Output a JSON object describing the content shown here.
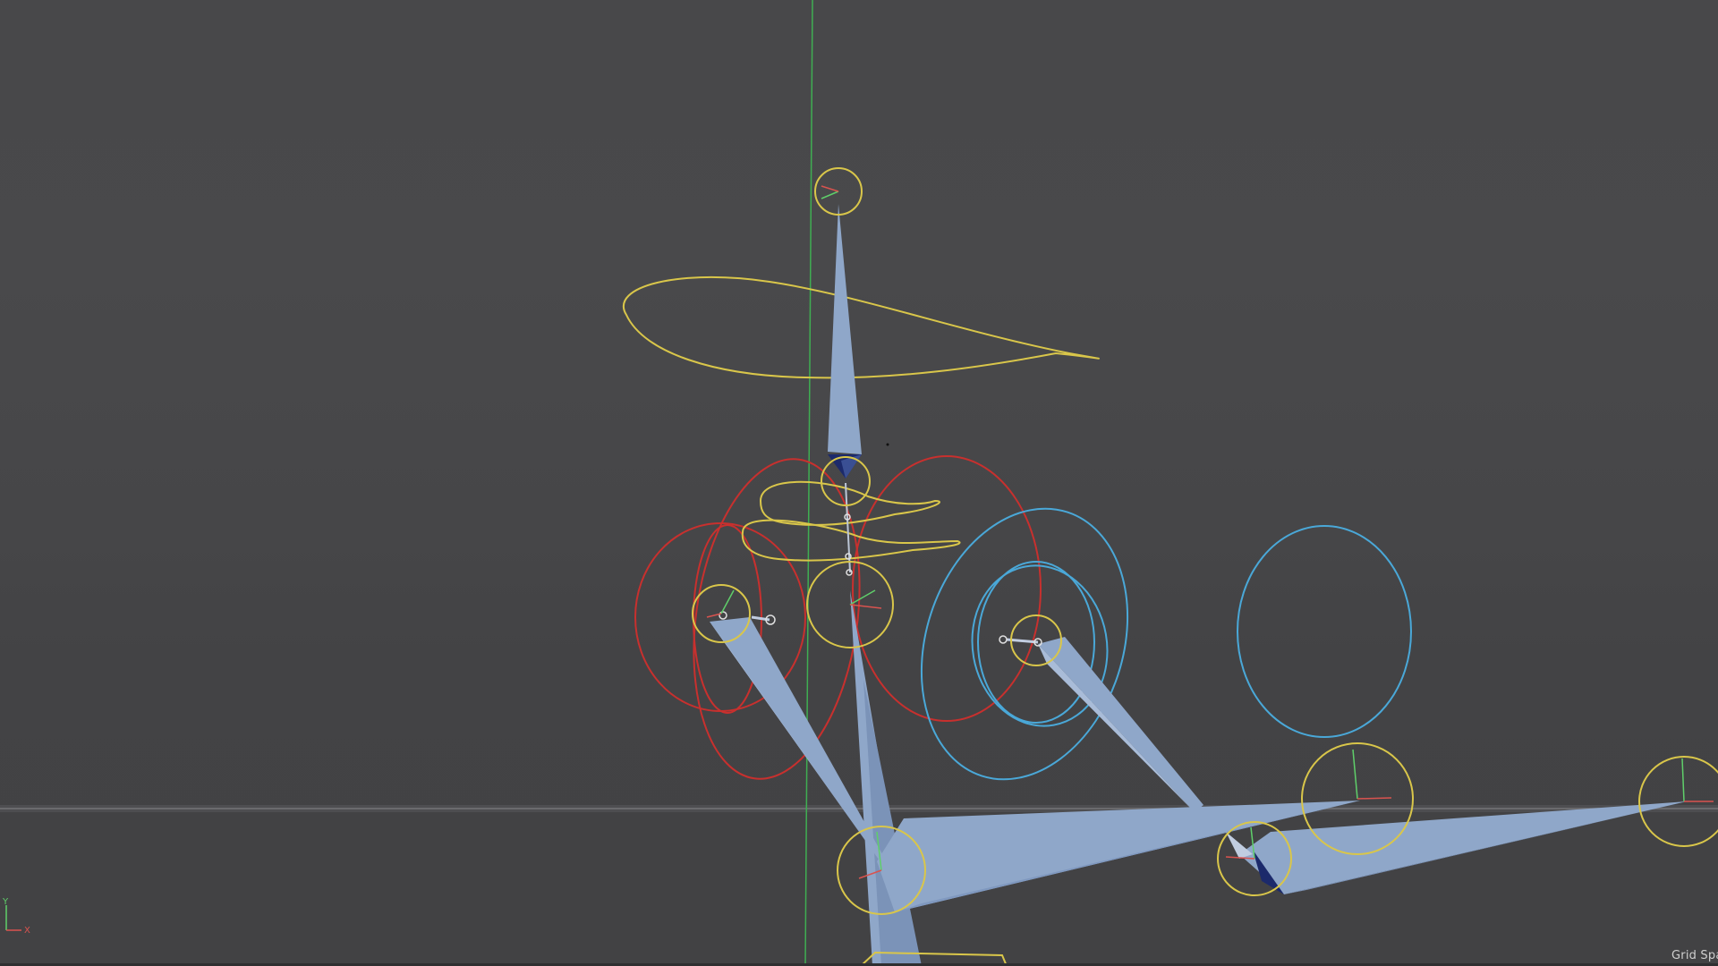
{
  "viewport": {
    "grid_spacing_label": "Grid Spa",
    "axis_gizmo": {
      "y_label": "Y",
      "x_label": "X"
    }
  },
  "colors": {
    "background": "#474749",
    "bone": "#8fa7c9",
    "bone_tip": "#1c2a6b",
    "joint_controller": "#d9c64a",
    "fk_controller_left": "#c8302e",
    "fk_controller_right": "#4aa8d8",
    "axis_x": "#d9534f",
    "axis_y": "#5fcf6a",
    "world_y_axis": "#3fae52"
  },
  "icons": [
    "axis-gizmo-icon"
  ]
}
